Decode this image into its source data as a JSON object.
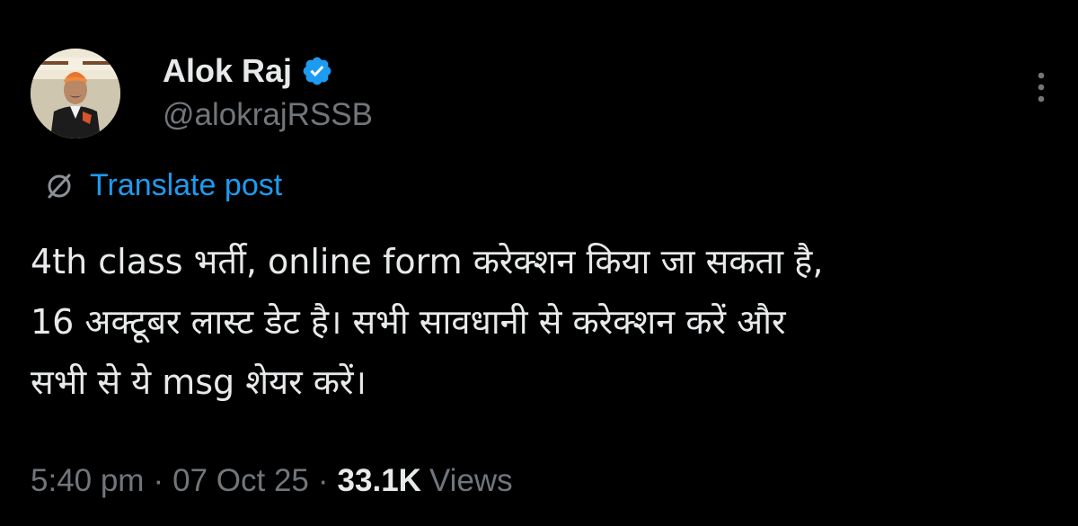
{
  "author": {
    "display_name": "Alok Raj",
    "handle": "@alokrajRSSB",
    "verified": true
  },
  "actions": {
    "more_icon": "more-vertical-icon"
  },
  "translate": {
    "label": "Translate post",
    "icon": "translate-icon"
  },
  "post": {
    "lines": [
      "4th class भर्ती, online form करेक्शन किया जा सकता है,",
      "16 अक्टूबर लास्ट डेट है। सभी सावधानी से करेक्शन करें और",
      "सभी से ये msg शेयर करें।"
    ]
  },
  "meta": {
    "time": "5:40 pm",
    "separator": "·",
    "date": "07 Oct 25",
    "views_count": "33.1K",
    "views_label": "Views"
  },
  "colors": {
    "background": "#000000",
    "text": "#e7e9ea",
    "secondary_text": "#71767b",
    "accent": "#1d9bf0"
  }
}
